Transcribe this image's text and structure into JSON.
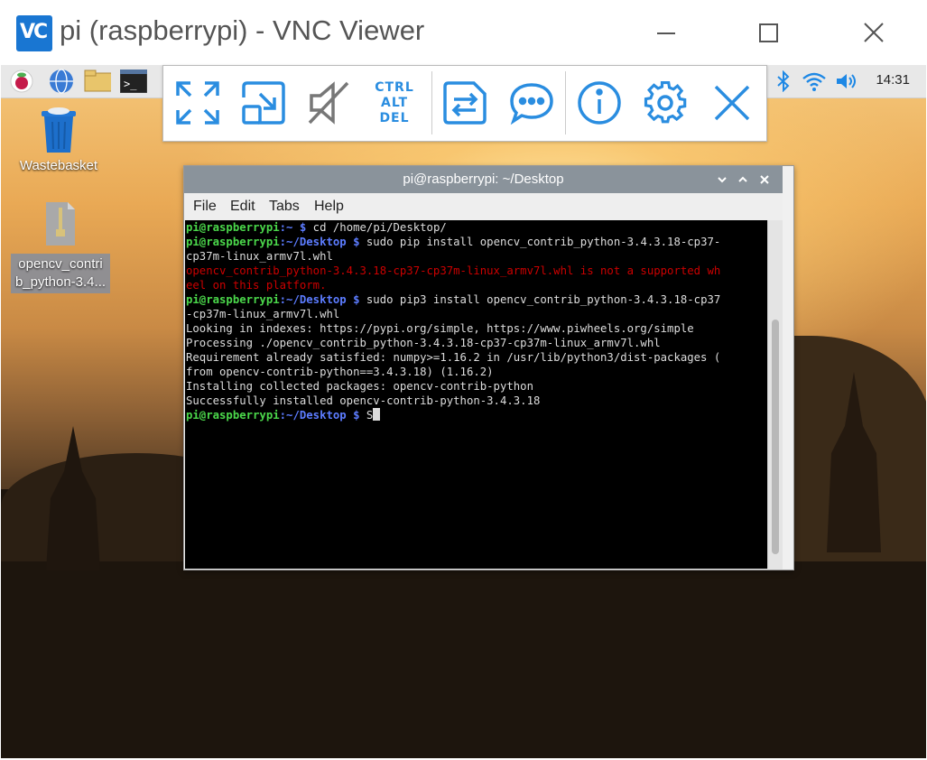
{
  "vnc_window": {
    "logo_text": "VC",
    "title": "pi (raspberrypi) - VNC Viewer"
  },
  "vnc_toolbar": {
    "ctrl_alt_del": [
      "CTRL",
      "ALT",
      "DEL"
    ]
  },
  "panel": {
    "clock": "14:31"
  },
  "desktop_icons": [
    {
      "label": "Wastebasket"
    },
    {
      "label_lines": [
        "opencv_contri",
        "b_python-3.4..."
      ]
    }
  ],
  "terminal": {
    "title": "pi@raspberrypi: ~/Desktop",
    "menu": [
      "File",
      "Edit",
      "Tabs",
      "Help"
    ],
    "lines": [
      {
        "user": "pi@raspberrypi",
        "path": ":~ $",
        "cmd": " cd /home/pi/Desktop/"
      },
      {
        "user": "pi@raspberrypi",
        "path": ":~/Desktop $",
        "cmd": " sudo pip install opencv_contrib_python-3.4.3.18-cp37-"
      },
      {
        "text": "cp37m-linux_armv7l.whl"
      },
      {
        "err": "opencv_contrib_python-3.4.3.18-cp37-cp37m-linux_armv7l.whl is not a supported wh"
      },
      {
        "err": "eel on this platform."
      },
      {
        "user": "pi@raspberrypi",
        "path": ":~/Desktop $",
        "cmd": " sudo pip3 install opencv_contrib_python-3.4.3.18-cp37"
      },
      {
        "text": "-cp37m-linux_armv7l.whl"
      },
      {
        "text": "Looking in indexes: https://pypi.org/simple, https://www.piwheels.org/simple"
      },
      {
        "text": "Processing ./opencv_contrib_python-3.4.3.18-cp37-cp37m-linux_armv7l.whl"
      },
      {
        "text": "Requirement already satisfied: numpy>=1.16.2 in /usr/lib/python3/dist-packages ("
      },
      {
        "text": "from opencv-contrib-python==3.4.3.18) (1.16.2)"
      },
      {
        "text": "Installing collected packages: opencv-contrib-python"
      },
      {
        "text": "Successfully installed opencv-contrib-python-3.4.3.18"
      },
      {
        "user": "pi@raspberrypi",
        "path": ":~/Desktop $",
        "cmd": " S",
        "cursor": true
      }
    ]
  },
  "colors": {
    "vnc_blue": "#1976d2",
    "toolbar_icon": "#2a8de0",
    "prompt_user": "#4bd84b",
    "prompt_path": "#5c7cff",
    "error_text": "#cc0000"
  }
}
